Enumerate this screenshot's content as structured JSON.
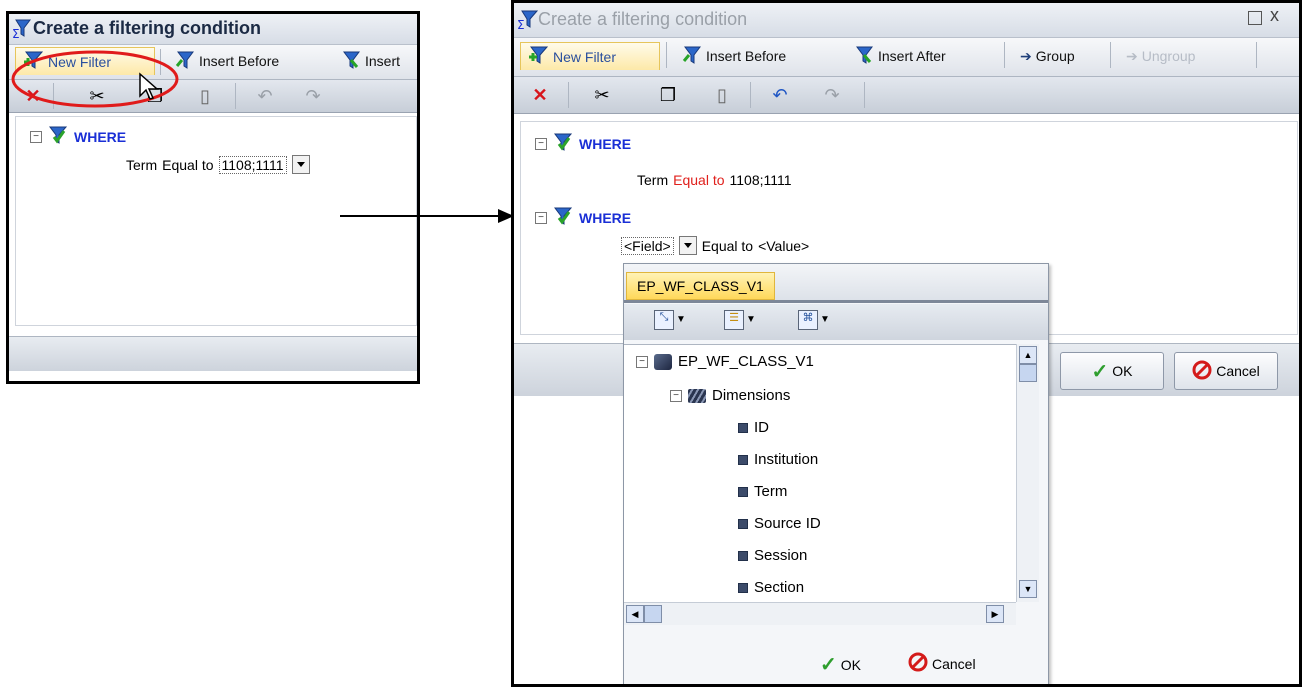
{
  "small_window": {
    "title": "Create a filtering condition",
    "tabs": [
      {
        "label": "New Filter"
      },
      {
        "label": "Insert Before"
      },
      {
        "label": "Insert"
      }
    ],
    "where_label": "WHERE",
    "condition": {
      "field": "Term",
      "operator": "Equal to",
      "value": "1108;1111"
    }
  },
  "large_window": {
    "title": "Create a filtering condition",
    "tabs": [
      {
        "label": "New Filter"
      },
      {
        "label": "Insert Before"
      },
      {
        "label": "Insert After"
      },
      {
        "label": "Group"
      },
      {
        "label": "Ungroup"
      }
    ],
    "conditions": [
      {
        "where_label": "WHERE",
        "field": "Term",
        "operator": "Equal to",
        "value": "1108;1111"
      },
      {
        "where_label": "WHERE",
        "field": "<Field>",
        "operator": "Equal to",
        "value": "<Value>"
      }
    ],
    "ok_label": "OK",
    "cancel_label": "Cancel"
  },
  "field_picker": {
    "tab_label": "EP_WF_CLASS_V1",
    "root": "EP_WF_CLASS_V1",
    "group": "Dimensions",
    "fields": [
      "ID",
      "Institution",
      "Term",
      "Source ID",
      "Session",
      "Section"
    ],
    "ok_label": "OK",
    "cancel_label": "Cancel"
  },
  "colors": {
    "where_blue": "#1a2fd6",
    "operator_red": "#e0201c",
    "highlight_red": "#e01b1b",
    "active_tab": "#fde9a8"
  }
}
